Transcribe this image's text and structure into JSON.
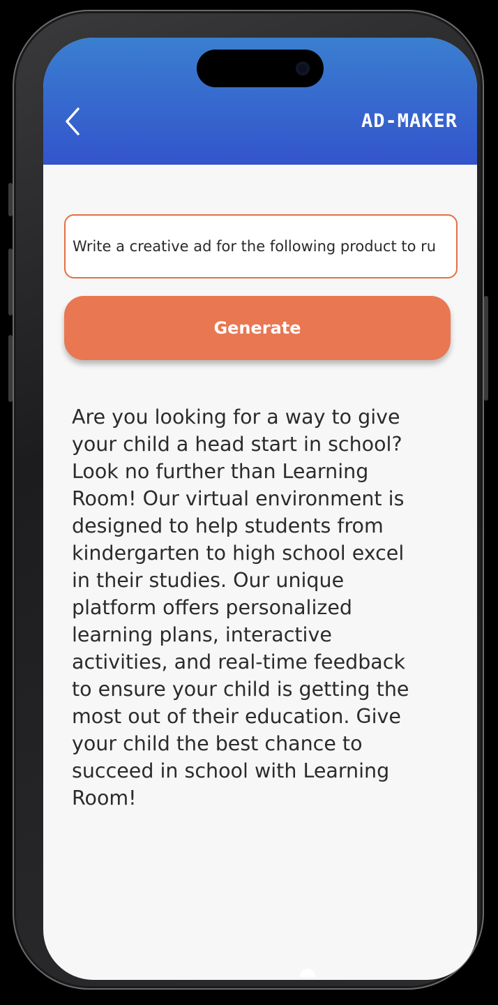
{
  "header": {
    "title": "AD-MAKER",
    "back_icon": "chevron-left-icon",
    "gradient_top": "#3a7fd0",
    "gradient_bottom": "#3354cc"
  },
  "prompt": {
    "value": "Write a creative ad for the following product to ru"
  },
  "generate_button": {
    "label": "Generate",
    "color": "#e87752"
  },
  "result": {
    "text": "Are you looking for a way to give your child a head start in school? Look no further than Learning Room! Our virtual environment is designed to help students from kindergarten to high school excel in their studies. Our unique platform offers personalized learning plans, interactive activities, and real-time feedback to ensure your child is getting the most out of their education. Give your child the best chance to succeed in school with Learning Room!"
  },
  "accent_color": "#e56e45"
}
